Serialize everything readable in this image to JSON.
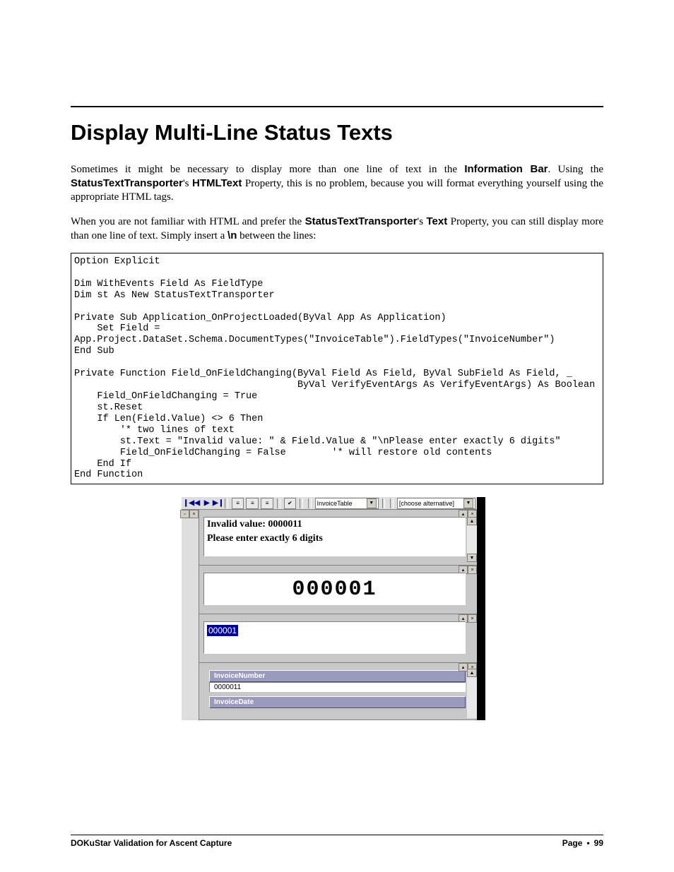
{
  "page_title": "Display Multi-Line Status Texts",
  "para1": {
    "t1": "Sometimes it might be necessary to display more than one line of text in the ",
    "b1": "Information Bar",
    "t2": ". Using the ",
    "b2": "StatusTextTransporter",
    "t3": "'s ",
    "b3": "HTMLText",
    "t4": " Property, this is no problem, because you will format everything yourself using the appropriate HTML tags."
  },
  "para2": {
    "t1": "When you are not familiar with HTML and prefer the ",
    "b1": "StatusTextTransporter",
    "t2": "'s ",
    "b2": "Text",
    "t3": " Property, you can still display more than one line of text. Simply insert a ",
    "b3": "\\n",
    "t4": " between the lines:"
  },
  "code": "Option Explicit\n\nDim WithEvents Field As FieldType\nDim st As New StatusTextTransporter\n\nPrivate Sub Application_OnProjectLoaded(ByVal App As Application)\n    Set Field =\nApp.Project.DataSet.Schema.DocumentTypes(\"InvoiceTable\").FieldTypes(\"InvoiceNumber\")\nEnd Sub\n\nPrivate Function Field_OnFieldChanging(ByVal Field As Field, ByVal SubField As Field, _\n                                       ByVal VerifyEventArgs As VerifyEventArgs) As Boolean\n    Field_OnFieldChanging = True\n    st.Reset\n    If Len(Field.Value) <> 6 Then\n        '* two lines of text\n        st.Text = \"Invalid value: \" & Field.Value & \"\\nPlease enter exactly 6 digits\"\n        Field_OnFieldChanging = False        '* will restore old contents\n    End If\nEnd Function",
  "figure": {
    "toolbar": {
      "nav": {
        "first": "❙◀",
        "prev": "◀",
        "next": "▶",
        "last": "▶❙"
      },
      "combo1": "InvoiceTable",
      "combo2": "[choose alternative]"
    },
    "info_line1": "Invalid value: 0000011",
    "info_line2": "Please enter exactly 6 digits",
    "big_number": "000001",
    "input_value": "000001",
    "fields": {
      "f1_label": "InvoiceNumber",
      "f1_value": "0000011",
      "f2_label": "InvoiceDate"
    }
  },
  "footer": {
    "left": "DOKuStar Validation for Ascent Capture",
    "right_label": "Page",
    "right_num": "99"
  }
}
